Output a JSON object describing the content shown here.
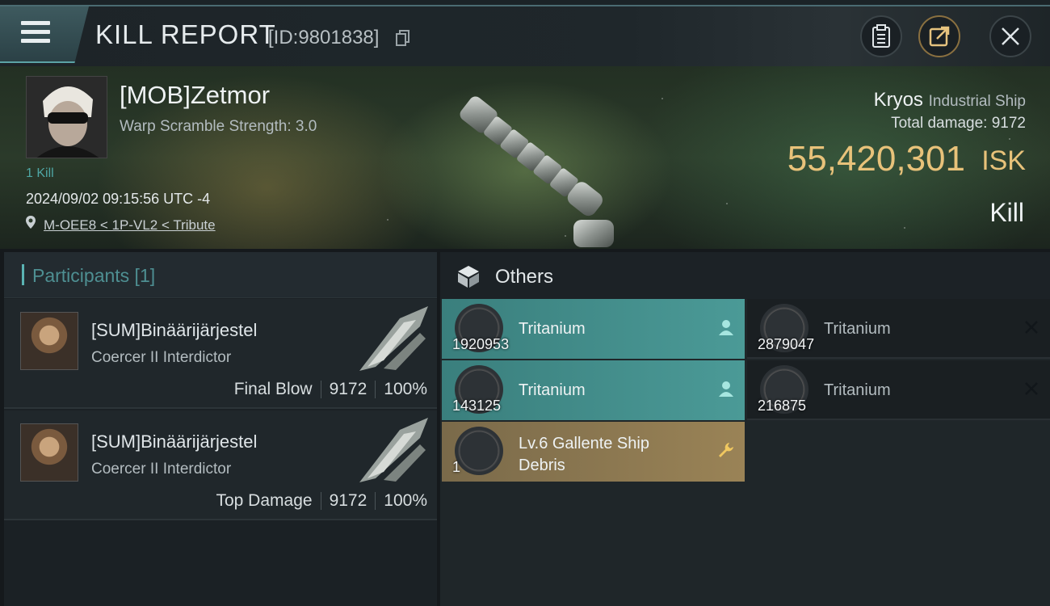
{
  "header": {
    "title": "KILL REPORT",
    "report_id": "[ID:9801838]"
  },
  "victim": {
    "pilot_name": "[MOB]Zetmor",
    "warp_scramble": "Warp Scramble Strength: 3.0",
    "kills": "1 Kill",
    "datetime": "2024/09/02 09:15:56 UTC -4",
    "location": "M-OEE8 < 1P-VL2 < Tribute",
    "ship_name": "Kryos",
    "ship_class": "Industrial Ship",
    "total_damage_label": "Total damage:",
    "total_damage": "9172",
    "isk_value": "55,420,301",
    "isk_label": "ISK",
    "result": "Kill"
  },
  "participants": {
    "title": "Participants [1]",
    "rows": [
      {
        "name": "[SUM]Binäärijärjestel",
        "ship": "Coercer II Interdictor",
        "role": "Final Blow",
        "damage": "9172",
        "percent": "100%"
      },
      {
        "name": "[SUM]Binäärijärjestel",
        "ship": "Coercer II Interdictor",
        "role": "Top Damage",
        "damage": "9172",
        "percent": "100%"
      }
    ]
  },
  "others": {
    "title": "Others",
    "items": [
      {
        "name": "Tritanium",
        "qty": "1920953",
        "state": "dropped"
      },
      {
        "name": "Tritanium",
        "qty": "2879047",
        "state": "destroyed"
      },
      {
        "name": "Tritanium",
        "qty": "143125",
        "state": "dropped"
      },
      {
        "name": "Tritanium",
        "qty": "216875",
        "state": "destroyed"
      },
      {
        "name": "Lv.6 Gallente Ship Debris",
        "qty": "1",
        "state": "salvage"
      }
    ]
  },
  "colors": {
    "accent_teal": "#4b9a97",
    "isk_gold": "#e8c27a",
    "salvage_gold": "#9a8356"
  }
}
